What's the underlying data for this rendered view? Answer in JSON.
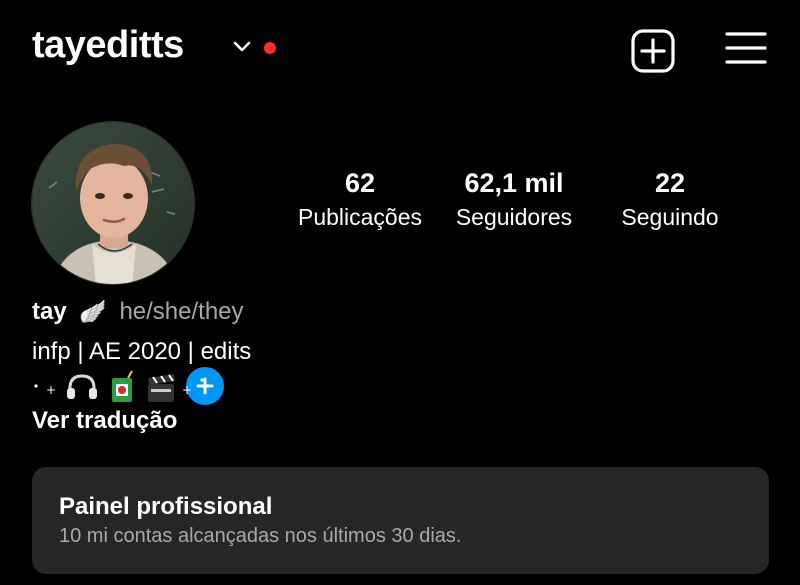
{
  "header": {
    "username": "tayeditts"
  },
  "profile": {
    "stats": [
      {
        "value": "62",
        "label": "Publicações"
      },
      {
        "value": "62,1 mil",
        "label": "Seguidores"
      },
      {
        "value": "22",
        "label": "Seguindo"
      }
    ],
    "name": "tay",
    "name_emoji": "🪽",
    "pronouns": "he/she/they",
    "bio_line": "infp | AE 2020 | edits",
    "translate_label": "Ver tradução"
  },
  "dashboard": {
    "title": "Painel profissional",
    "subtitle": "10 mi contas alcançadas nos últimos 30 dias."
  },
  "colors": {
    "background": "#000000",
    "accent_blue": "#0095f6",
    "notification_red": "#ff2d2d",
    "panel_bg": "#262626",
    "secondary_text": "#a8a8a8"
  }
}
